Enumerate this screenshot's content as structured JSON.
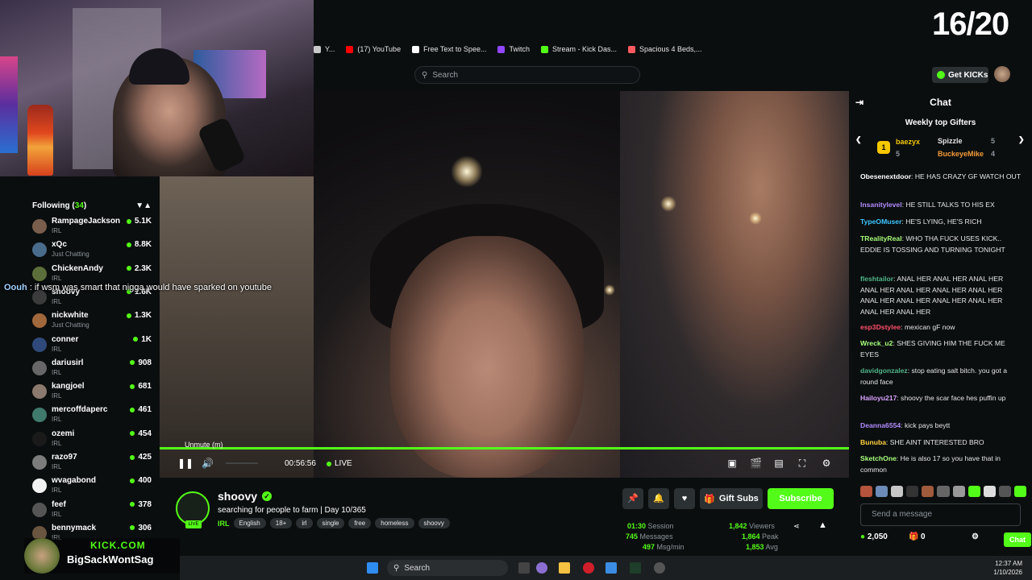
{
  "overlay": {
    "counter": "16/20"
  },
  "bookmarks": [
    {
      "label": "Y...",
      "color": "#c8c8c8"
    },
    {
      "label": "(17) YouTube",
      "color": "#ff0000"
    },
    {
      "label": "Free Text to Spee...",
      "color": "#ffffff"
    },
    {
      "label": "Twitch",
      "color": "#9146ff"
    },
    {
      "label": "Stream - Kick Das...",
      "color": "#53fc18"
    },
    {
      "label": "Spacious 4 Beds,...",
      "color": "#ff5a5f"
    }
  ],
  "header": {
    "search_placeholder": "Search",
    "get_kicks": "Get KICKs"
  },
  "sidebar": {
    "following_label": "Following (",
    "following_count": "34",
    "following_close": ")",
    "channels": [
      {
        "name": "RampageJackson",
        "category": "IRL",
        "viewers": "5.1K",
        "color": "#7a5e4d"
      },
      {
        "name": "xQc",
        "category": "Just Chatting",
        "viewers": "8.8K",
        "color": "#4a6c8c"
      },
      {
        "name": "ChickenAndy",
        "category": "IRL",
        "viewers": "2.3K",
        "color": "#5c6f3a"
      },
      {
        "name": "shoovy",
        "category": "IRL",
        "viewers": "1.6K",
        "color": "#3b3b3b"
      },
      {
        "name": "nickwhite",
        "category": "Just Chatting",
        "viewers": "1.3K",
        "color": "#a1683c"
      },
      {
        "name": "conner",
        "category": "IRL",
        "viewers": "1K",
        "color": "#2f4a7a"
      },
      {
        "name": "dariusirl",
        "category": "IRL",
        "viewers": "908",
        "color": "#676767"
      },
      {
        "name": "kangjoel",
        "category": "IRL",
        "viewers": "681",
        "color": "#8d7a6e"
      },
      {
        "name": "mercoffdaperc",
        "category": "IRL",
        "viewers": "461",
        "color": "#3f7a6c"
      },
      {
        "name": "ozemi",
        "category": "IRL",
        "viewers": "454",
        "color": "#1a1a1a"
      },
      {
        "name": "razo97",
        "category": "IRL",
        "viewers": "425",
        "color": "#7c7c7c"
      },
      {
        "name": "wvagabond",
        "category": "IRL",
        "viewers": "400",
        "color": "#f2f2f2"
      },
      {
        "name": "feef",
        "category": "IRL",
        "viewers": "378",
        "color": "#555555"
      },
      {
        "name": "bennymack",
        "category": "IRL",
        "viewers": "306",
        "color": "#6a5540"
      }
    ]
  },
  "overlay_message": {
    "user": "Oouh",
    "text": " : if wsm was smart that nigga would have sparked on youtube"
  },
  "player": {
    "tooltip": "Unmute (m)",
    "time": "00:56:56",
    "live": "LIVE",
    "progress": 1.0
  },
  "stream": {
    "name": "shoovy",
    "title": "searching for people to farm | Day 10/365",
    "category": "IRL",
    "tags": [
      "English",
      "18+",
      "irl",
      "single",
      "free",
      "homeless",
      "shoovy"
    ],
    "avatar_badge": "LIVE",
    "gift_subs": "Gift Subs",
    "subscribe": "Subscribe"
  },
  "stats": {
    "session": "01:30",
    "session_label": "Session",
    "messages": "745",
    "messages_label": "Messages",
    "msg_min": "497",
    "msg_min_label": "Msg/min",
    "viewers": "1,842",
    "viewers_label": "Viewers",
    "peak": "1,864",
    "peak_label": "Peak",
    "avg": "1,853",
    "avg_label": "Avg"
  },
  "chat": {
    "title": "Chat",
    "gifters_title": "Weekly top Gifters",
    "gifters": [
      {
        "name": "baezyx",
        "count": "5"
      },
      {
        "name": "Spizzle",
        "count": "5"
      },
      {
        "name": "BuckeyeMike",
        "count": "4"
      }
    ],
    "messages": [
      {
        "user": "Obesenextdoor",
        "text": ": HE HAS CRAZY GF WATCH OUT",
        "color": "#ffffff"
      },
      {
        "user": "Insanitylevel",
        "text": ": HE STILL TALKS TO HIS EX",
        "color": "#b18cff"
      },
      {
        "user": "TypeOMuser",
        "text": ": HE'S LYING, HE'S RICH",
        "color": "#3ec7ff"
      },
      {
        "user": "TRealityReal",
        "text": ": WHO THA FUCK USES KICK.. EDDIE IS TOSSING AND TURNING TONIGHT",
        "color": "#a6ff7a"
      },
      {
        "user": "fleshtailor",
        "text": ": ANAL HER ANAL HER ANAL HER ANAL HER ANAL HER ANAL HER ANAL HER ANAL HER ANAL HER ANAL HER ANAL HER ANAL HER ANAL HER",
        "color": "#4fb58a"
      },
      {
        "user": "esp3Dstylee",
        "text": ": mexican gF now",
        "color": "#ff4d6a"
      },
      {
        "user": "Wreck_u2",
        "text": ": SHES GIVING HIM THE FUCK ME EYES",
        "color": "#a6ff7a"
      },
      {
        "user": "davidgonzalez",
        "text": ": stop eating salt bitch. you got a round face",
        "color": "#4fb58a"
      },
      {
        "user": "Hailoyu217",
        "text": ": shoovy the scar face  hes puffin up",
        "color": "#d9a3ff"
      },
      {
        "user": "Deanna6554",
        "text": ": kick pays beytt",
        "color": "#b18cff"
      },
      {
        "user": "Bunuba",
        "text": ": SHE AINT INTERESTED BRO",
        "color": "#ffd23e"
      },
      {
        "user": "SketchOne",
        "text": ": He is also 17 so you have that in common",
        "color": "#a6ff7a"
      }
    ],
    "input_placeholder": "Send a message",
    "kicks_balance": "2,050",
    "drops": "0",
    "send_label": "Chat"
  },
  "kick_overlay": {
    "brand": "KICK.COM",
    "name": "BigSackWontSag"
  },
  "taskbar": {
    "search": "Search",
    "time": "12:37 AM",
    "date": "1/10/2026"
  }
}
